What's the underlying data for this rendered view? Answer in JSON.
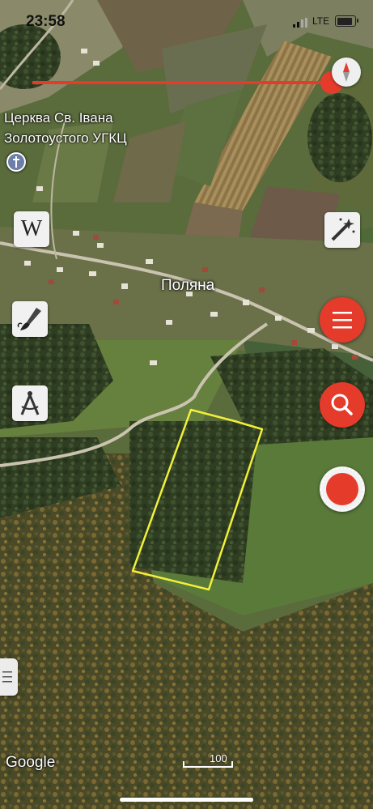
{
  "status_bar": {
    "time": "23:58",
    "network": "LTE"
  },
  "map": {
    "poi_name": "Церква Св. Івана\nЗолотоустого УГКЦ",
    "place_name": "Поляна",
    "attribution": "Google",
    "scale_label": "100",
    "outline_color": "#f2f03a"
  },
  "toolbar": {
    "left": [
      "wikipedia-icon",
      "paintbrush-icon",
      "compass-drafting-icon"
    ],
    "right": [
      "magic-wand-icon",
      "menu-icon",
      "search-icon",
      "record-icon"
    ],
    "accent_color": "#e53b2b"
  }
}
